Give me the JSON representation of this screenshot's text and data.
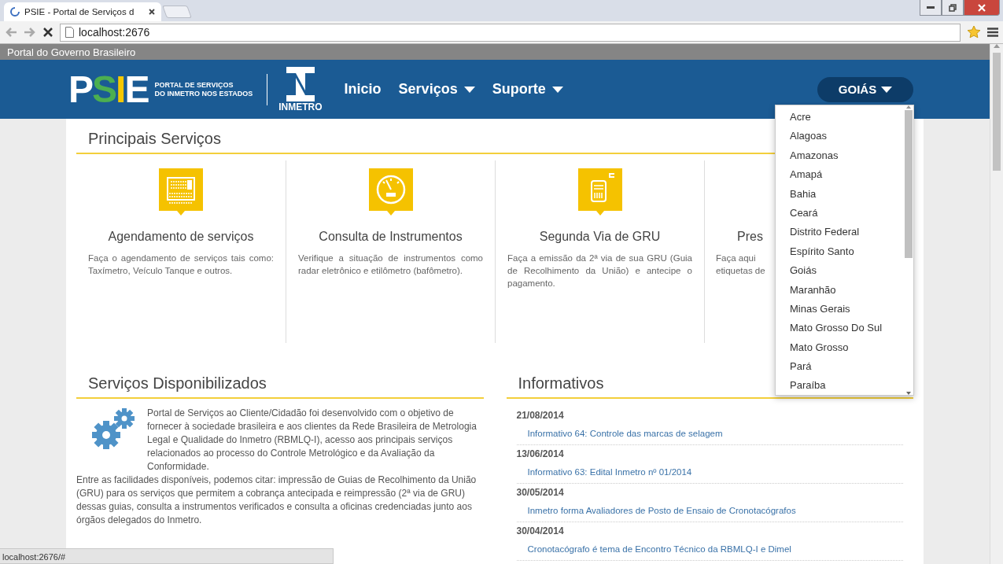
{
  "browser": {
    "tab_title": "PSIE - Portal de Serviços d",
    "address": "localhost:2676",
    "loading": true
  },
  "gov_bar": "Portal do Governo Brasileiro",
  "header": {
    "logo_letters": [
      {
        "text": "P",
        "color": "#ffffff"
      },
      {
        "text": "S",
        "color": "#4caf50"
      },
      {
        "text": "I",
        "color": "#f5c800"
      },
      {
        "text": "E",
        "color": "#ffffff"
      }
    ],
    "logo_subtitle": [
      "PORTAL DE SERVIÇOS",
      "DO INMETRO NOS ESTADOS"
    ],
    "inmetro_label": "INMETRO",
    "nav": [
      {
        "label": "Inicio",
        "dropdown": false
      },
      {
        "label": "Serviços",
        "dropdown": true
      },
      {
        "label": "Suporte",
        "dropdown": true
      }
    ],
    "state_button": {
      "label": "GOIÁS",
      "expanded": true
    }
  },
  "state_menu": [
    "Acre",
    "Alagoas",
    "Amazonas",
    "Amapá",
    "Bahia",
    "Ceará",
    "Distrito Federal",
    "Espírito Santo",
    "Goiás",
    "Maranhão",
    "Minas Gerais",
    "Mato Grosso Do Sul",
    "Mato Grosso",
    "Pará",
    "Paraíba"
  ],
  "principais": {
    "title": "Principais Serviços",
    "cards": [
      {
        "kind": "calendar",
        "title": "Agendamento de serviços",
        "description": "Faça o agendamento de serviços tais como: Taxímetro, Veículo Tanque e outros."
      },
      {
        "kind": "gauge",
        "title": "Consulta de Instrumentos",
        "description": "Verifique a situação de instrumentos como radar eletrônico e etilômetro (bafômetro)."
      },
      {
        "kind": "receipt",
        "title": "Segunda Via de GRU",
        "description": "Faça a emissão da 2ª via de sua GRU (Guia de Recolhimento da União) e antecipe o pagamento."
      },
      {
        "kind": "none",
        "title": "Pres",
        "description": [
          "Faça aqui",
          "etiquetas de"
        ]
      }
    ]
  },
  "disponibilizados": {
    "title": "Serviços Disponibilizados",
    "paragraphs": [
      "Portal de Serviços ao Cliente/Cidadão foi desenvolvido com o objetivo de fornecer à sociedade brasileira e aos clientes da Rede Brasileira de Metrologia Legal e Qualidade do Inmetro (RBMLQ-I), acesso aos principais serviços relacionados ao processo do Controle Metrológico e da Avaliação da Conformidade.",
      "Entre as facilidades disponíveis, podemos citar: impressão de Guias de Recolhimento da União (GRU) para os serviços que permitem a cobrança antecipada e reimpressão (2ª via de GRU) dessas guias, consulta a instrumentos verificados e consulta a oficinas credenciadas junto aos órgãos delegados do Inmetro."
    ]
  },
  "informativos": {
    "title": "Informativos",
    "items": [
      {
        "date": "21/08/2014",
        "title": "Informativo 64: Controle das marcas de selagem"
      },
      {
        "date": "13/06/2014",
        "title": "Informativo 63: Edital Inmetro nº 01/2014"
      },
      {
        "date": "30/05/2014",
        "title": "Inmetro forma Avaliadores de Posto de Ensaio de Cronotacógrafos"
      },
      {
        "date": "30/04/2014",
        "title": "Cronotacógrafo é tema de Encontro Técnico da RBMLQ-I e Dimel"
      }
    ]
  },
  "status_bar": "localhost:2676/#"
}
